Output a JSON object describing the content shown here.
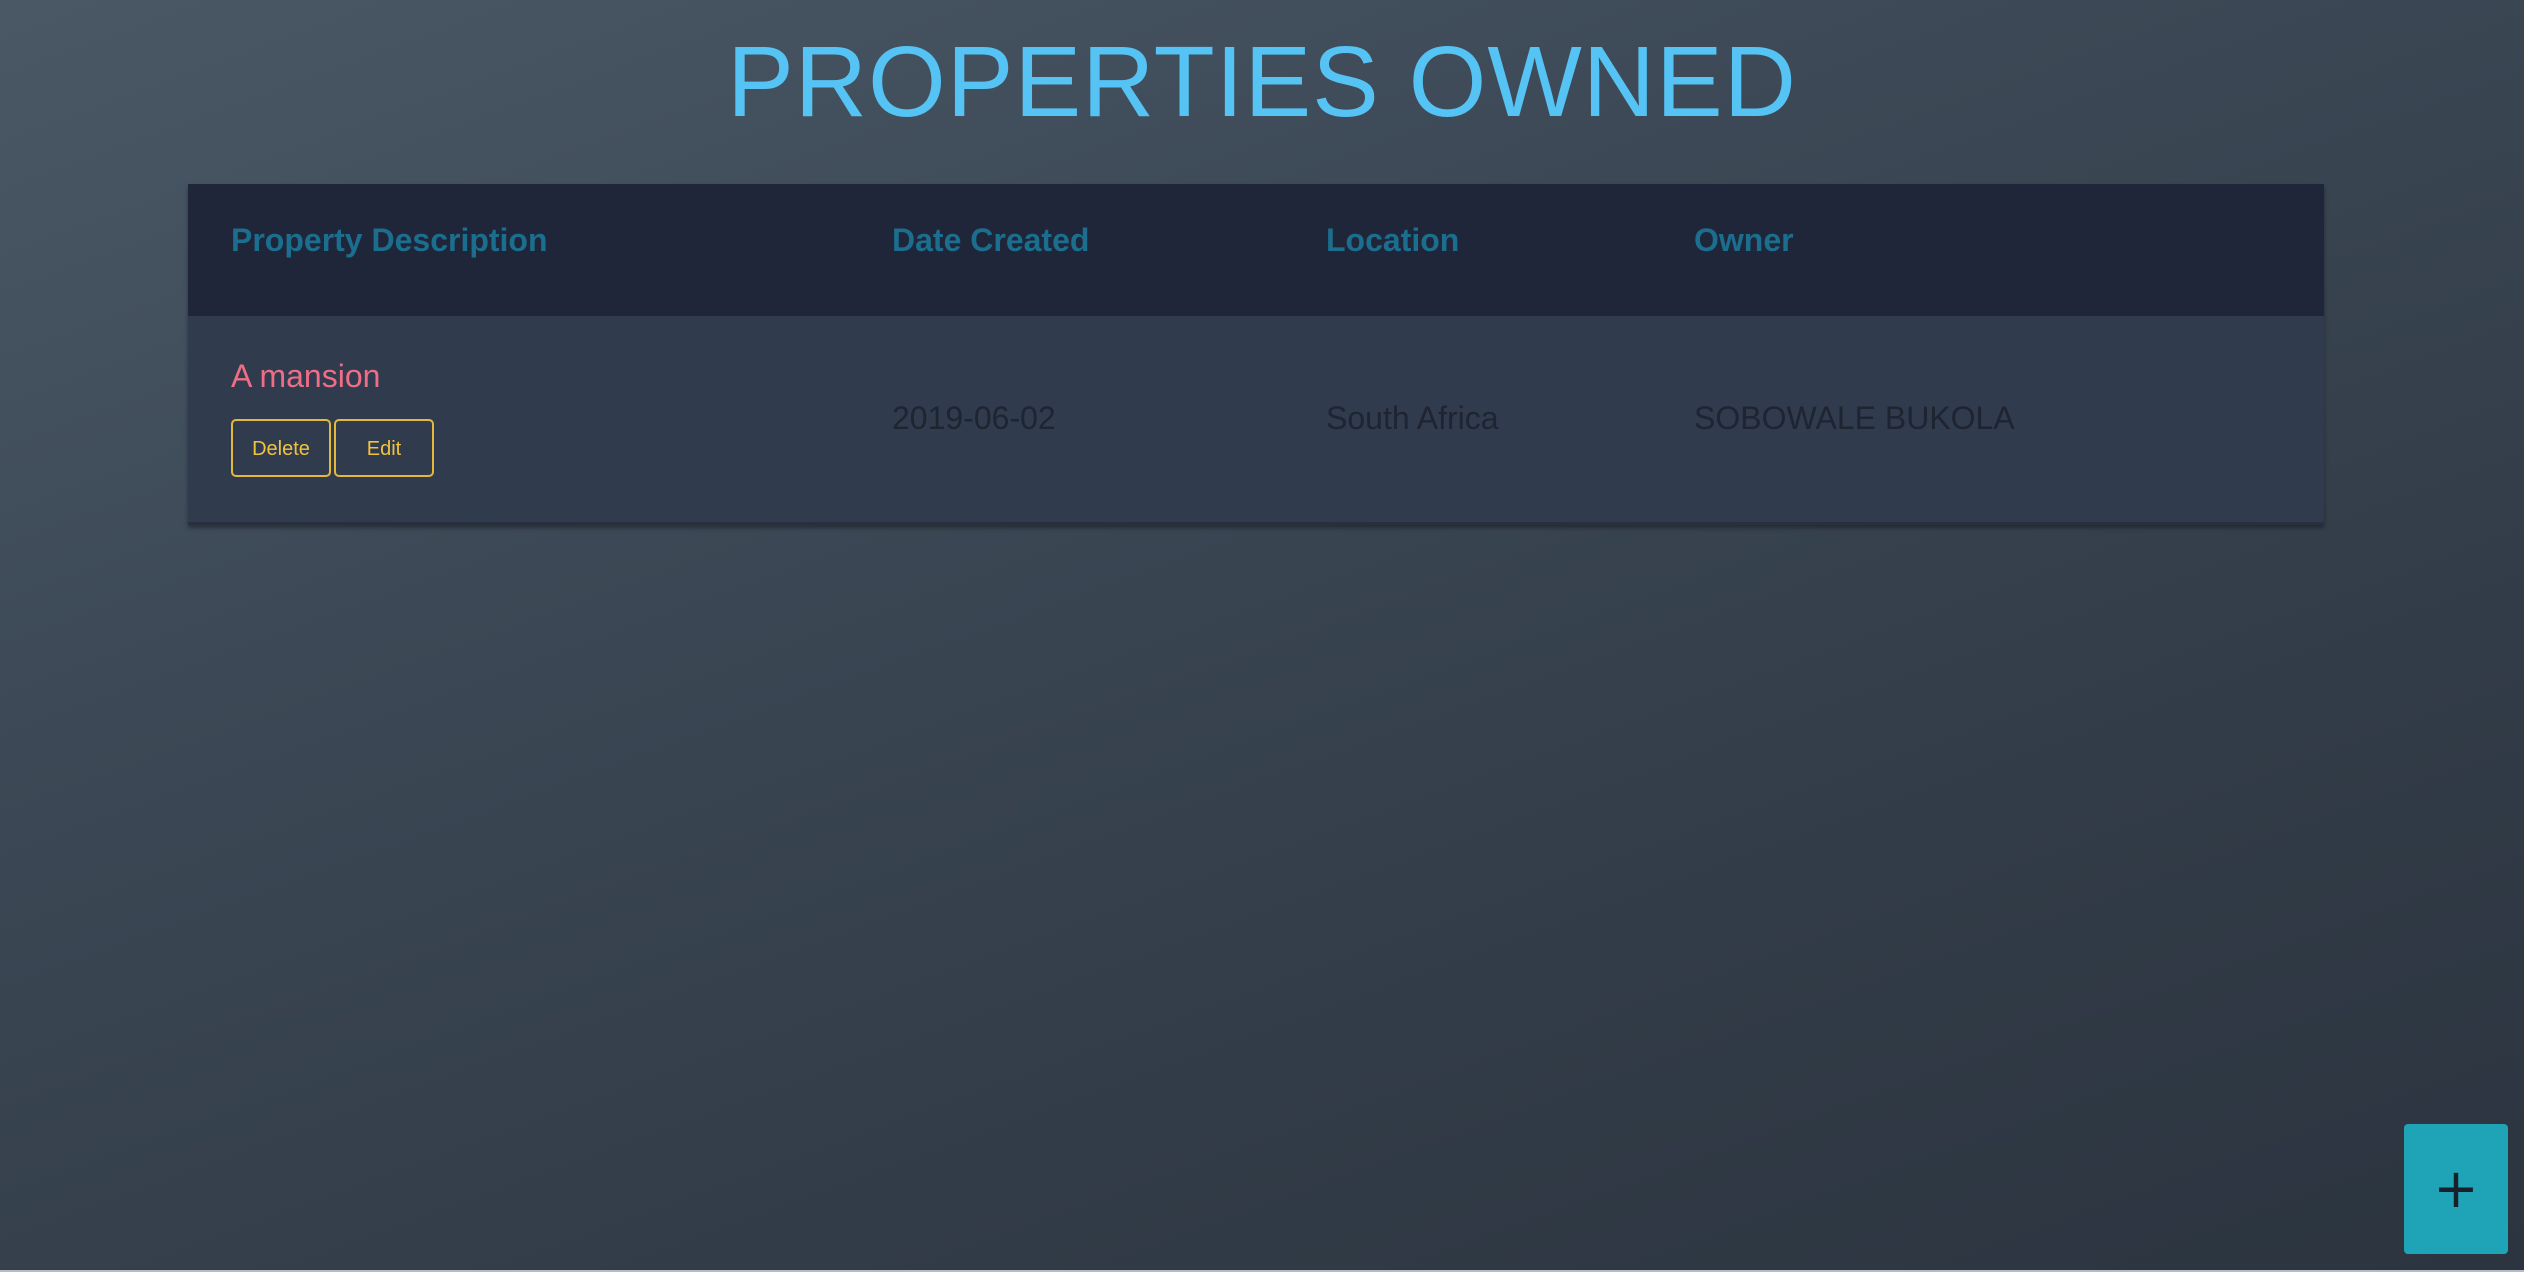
{
  "page": {
    "title": "PROPERTIES OWNED"
  },
  "table": {
    "headers": {
      "description": "Property Description",
      "date": "Date Created",
      "location": "Location",
      "owner": "Owner"
    },
    "rows": [
      {
        "description": "A mansion",
        "date_created": "2019-06-02",
        "location": "South Africa",
        "owner": "SOBOWALE BUKOLA",
        "delete_label": "Delete",
        "edit_label": "Edit"
      }
    ]
  },
  "fab": {
    "label": "+",
    "icon": "plus-icon"
  },
  "colors": {
    "title": "#55c3f3",
    "header_text": "#1b6e8d",
    "description_text": "#ef6d86",
    "button_border": "#e4b93a",
    "fab_background": "#1fa3b6"
  }
}
